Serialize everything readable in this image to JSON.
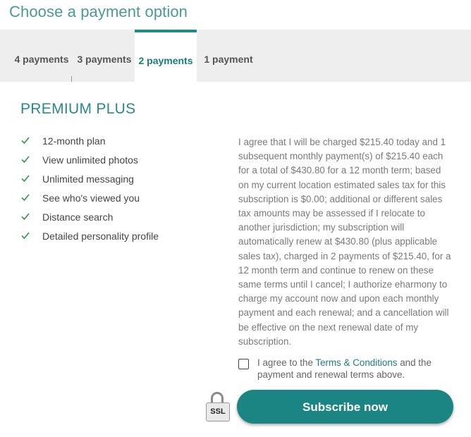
{
  "page": {
    "title": "Choose a payment option"
  },
  "tabs": [
    {
      "label": "4 payments",
      "active": false
    },
    {
      "label": "3 payments",
      "active": false
    },
    {
      "label": "2 payments",
      "active": true
    },
    {
      "label": "1 payment",
      "active": false
    }
  ],
  "plan": {
    "name": "PREMIUM PLUS",
    "features": [
      "12-month plan",
      "View unlimited photos",
      "Unlimited messaging",
      "See who's viewed you",
      "Distance search",
      "Detailed personality profile"
    ]
  },
  "terms": {
    "text": "I agree that I will be charged $215.40 today and 1 subsequent monthly payment(s) of $215.40 each for a total of $430.80 for a 12 month term; based on my current location estimated sales tax for this subscription is $0.00; additional or different sales tax amounts may be assessed if I relocate to another jurisdiction; my subscription will automatically renew at $430.80 (plus applicable sales tax), charged in 2 payments of $215.40, for a 12 month term and continue to renew on these same terms until I cancel; I authorize eharmony to charge my account now and upon each monthly payment and each renewal; and a cancellation will be effective on the next renewal date of my subscription."
  },
  "agreement": {
    "prefix": "I agree to the ",
    "link": "Terms & Conditions",
    "suffix": " and the payment and renewal terms above.",
    "checked": false
  },
  "ssl": {
    "label": "SSL"
  },
  "cta": {
    "label": "Subscribe now"
  },
  "colors": {
    "accent": "#1a8582",
    "title": "#4a9a9a",
    "check": "#2e9a4a"
  }
}
